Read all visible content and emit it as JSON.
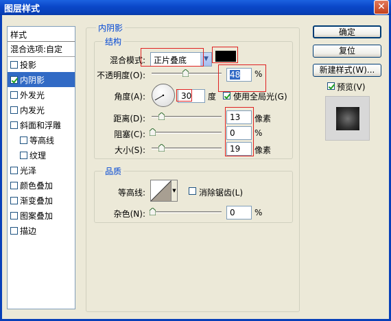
{
  "window": {
    "title": "图层样式",
    "close_label": "✕"
  },
  "sidebar": {
    "header": "样式",
    "items": [
      {
        "label": "混合选项:自定",
        "checkbox": false,
        "checked": false,
        "indent": false,
        "selected": false
      },
      {
        "label": "投影",
        "checkbox": true,
        "checked": false,
        "indent": false,
        "selected": false
      },
      {
        "label": "内阴影",
        "checkbox": true,
        "checked": true,
        "indent": false,
        "selected": true
      },
      {
        "label": "外发光",
        "checkbox": true,
        "checked": false,
        "indent": false,
        "selected": false
      },
      {
        "label": "内发光",
        "checkbox": true,
        "checked": false,
        "indent": false,
        "selected": false
      },
      {
        "label": "斜面和浮雕",
        "checkbox": true,
        "checked": false,
        "indent": false,
        "selected": false
      },
      {
        "label": "等高线",
        "checkbox": true,
        "checked": false,
        "indent": true,
        "selected": false
      },
      {
        "label": "纹理",
        "checkbox": true,
        "checked": false,
        "indent": true,
        "selected": false
      },
      {
        "label": "光泽",
        "checkbox": true,
        "checked": false,
        "indent": false,
        "selected": false
      },
      {
        "label": "颜色叠加",
        "checkbox": true,
        "checked": false,
        "indent": false,
        "selected": false
      },
      {
        "label": "渐变叠加",
        "checkbox": true,
        "checked": false,
        "indent": false,
        "selected": false
      },
      {
        "label": "图案叠加",
        "checkbox": true,
        "checked": false,
        "indent": false,
        "selected": false
      },
      {
        "label": "描边",
        "checkbox": true,
        "checked": false,
        "indent": false,
        "selected": false
      }
    ]
  },
  "panel": {
    "title": "内阴影",
    "structure": {
      "title": "结构",
      "blend_mode_label": "混合模式:",
      "blend_mode_value": "正片叠底",
      "shadow_color": "#000000",
      "opacity_label": "不透明度(O):",
      "opacity_value": "48",
      "opacity_unit": "%",
      "opacity_level": 0.48,
      "angle_label": "角度(A):",
      "angle_value": "30",
      "angle_unit": "度",
      "angle_degrees": 30,
      "global_light_label": "使用全局光(G)",
      "global_light_checked": true,
      "distance_label": "距离(D):",
      "distance_value": "13",
      "distance_unit": "像素",
      "choke_label": "阻塞(C):",
      "choke_value": "0",
      "choke_unit": "%",
      "size_label": "大小(S):",
      "size_value": "19",
      "size_unit": "像素"
    },
    "quality": {
      "title": "品质",
      "contour_label": "等高线:",
      "anti_alias_label": "消除锯齿(L)",
      "anti_alias_checked": false,
      "noise_label": "杂色(N):",
      "noise_value": "0",
      "noise_unit": "%"
    }
  },
  "buttons": {
    "ok": "确定",
    "reset": "复位",
    "new_style": "新建样式(W)...",
    "preview_label": "预览(V)",
    "preview_checked": true
  }
}
